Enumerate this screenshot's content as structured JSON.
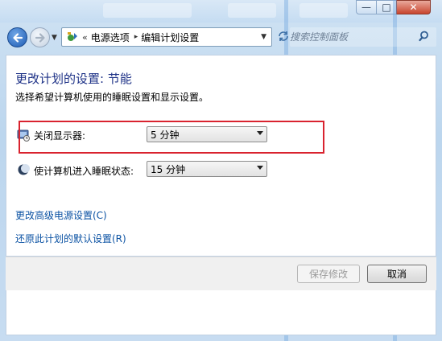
{
  "window": {
    "minimize_symbol": "—",
    "maximize_symbol": "□",
    "close_symbol": "✕"
  },
  "navbar": {
    "back_icon": "back-arrow-icon",
    "forward_icon": "forward-arrow-icon",
    "breadcrumb": {
      "separator": "«",
      "items": [
        "电源选项",
        "编辑计划设置"
      ]
    },
    "search": {
      "placeholder": "搜索控制面板"
    }
  },
  "main": {
    "title": "更改计划的设置: 节能",
    "subtitle": "选择希望计算机使用的睡眠设置和显示设置。",
    "settings": [
      {
        "label": "关闭显示器:",
        "value": "5 分钟",
        "icon": "monitor-icon"
      },
      {
        "label": "使计算机进入睡眠状态:",
        "value": "15 分钟",
        "icon": "moon-icon"
      }
    ],
    "links": [
      "更改高级电源设置(C)",
      "还原此计划的默认设置(R)"
    ]
  },
  "footer": {
    "save_label": "保存修改",
    "cancel_label": "取消"
  },
  "colors": {
    "heading": "#1e3287",
    "link": "#0b52a3",
    "highlight_box": "#d9232f"
  }
}
